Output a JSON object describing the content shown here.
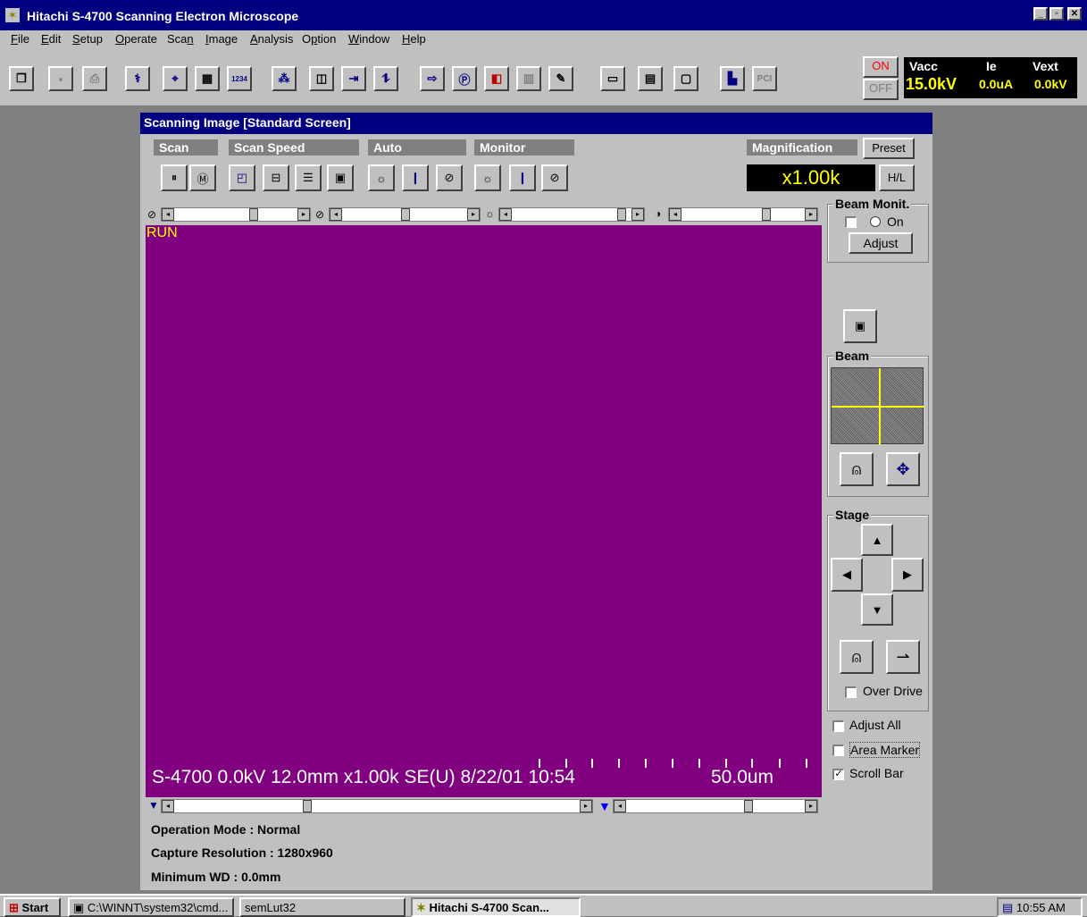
{
  "window": {
    "title": "Hitachi S-4700 Scanning Electron Microscope",
    "controls": {
      "min": "_",
      "max": "▫",
      "close": "✕"
    }
  },
  "menu": [
    {
      "label": "File",
      "u": "F"
    },
    {
      "label": "Edit",
      "u": "E"
    },
    {
      "label": "Setup",
      "u": "S"
    },
    {
      "label": "Operate",
      "u": "O"
    },
    {
      "label": "Scan",
      "u": "n"
    },
    {
      "label": "Image",
      "u": "I"
    },
    {
      "label": "Analysis",
      "u": "A"
    },
    {
      "label": "Option",
      "u": "p"
    },
    {
      "label": "Window",
      "u": "W"
    },
    {
      "label": "Help",
      "u": "H"
    }
  ],
  "power": {
    "on": "ON",
    "off": "OFF"
  },
  "status_panel": {
    "vacc_label": "Vacc",
    "vacc_value": "15.0kV",
    "ie_label": "Ie",
    "ie_value": "0.0uA",
    "vext_label": "Vext",
    "vext_value": "0.0kV"
  },
  "child_window": {
    "title": "Scanning Image [Standard Screen]",
    "groups": {
      "scan": "Scan",
      "scan_speed": "Scan Speed",
      "auto": "Auto",
      "monitor": "Monitor",
      "magnification": "Magnification"
    },
    "preset": "Preset",
    "magnification_value": "x1.00k",
    "hl": "H/L",
    "run": "RUN",
    "info_bar": "S-4700 0.0kV 12.0mm x1.00k SE(U) 8/22/01 10:54",
    "scale_bar": "50.0um",
    "status": {
      "operation_mode": "Operation Mode : Normal",
      "capture_resolution": "Capture Resolution : 1280x960",
      "minimum_wd": "Minimum WD : 0.0mm"
    }
  },
  "right_panel": {
    "beam_monit": "Beam Monit.",
    "on": "On",
    "adjust": "Adjust",
    "beam": "Beam",
    "stage": "Stage",
    "over_drive": "Over Drive",
    "adjust_all": "Adjust All",
    "area_marker": "Area Marker",
    "scroll_bar": "Scroll Bar"
  },
  "taskbar": {
    "start": "Start",
    "tasks": [
      "C:\\WINNT\\system32\\cmd...",
      "semLut32",
      "Hitachi S-4700 Scan..."
    ],
    "clock": "10:55 AM"
  },
  "colors": {
    "scan_bg": "#800080",
    "title_blue": "#000080",
    "mag_text": "#ffff00"
  }
}
